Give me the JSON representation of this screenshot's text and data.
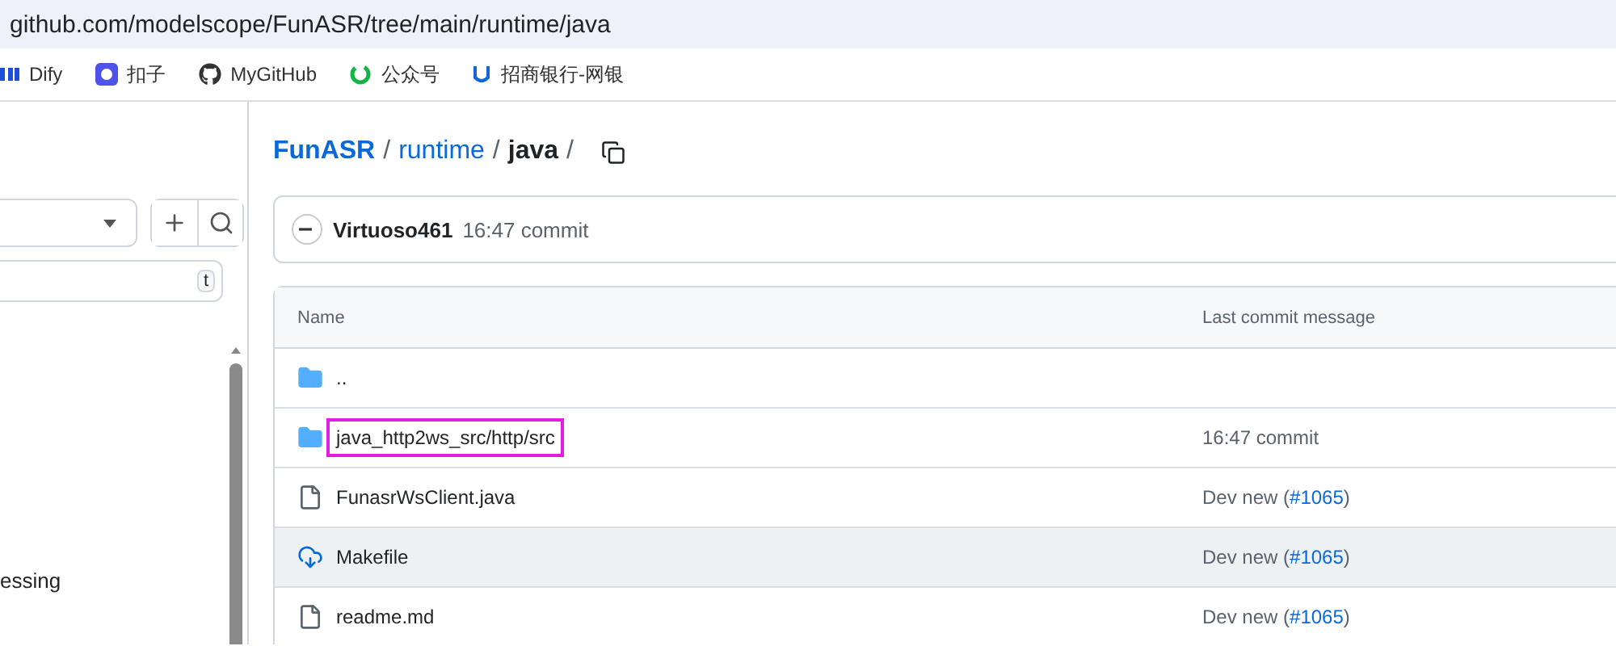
{
  "browser": {
    "url": "github.com/modelscope/FunASR/tree/main/runtime/java",
    "bookmarks": [
      {
        "label": "Dify"
      },
      {
        "label": "扣子"
      },
      {
        "label": "MyGitHub"
      },
      {
        "label": "公众号"
      },
      {
        "label": "招商银行-网银"
      }
    ]
  },
  "sidebar": {
    "search_shortcut": "t",
    "items": [
      {
        "label": "essing"
      }
    ]
  },
  "breadcrumb": [
    {
      "label": "FunASR",
      "kind": "repo",
      "separator": "/"
    },
    {
      "label": "runtime",
      "kind": "link",
      "separator": "/"
    },
    {
      "label": "java",
      "kind": "current",
      "separator": "/"
    }
  ],
  "latest_commit": {
    "author": "Virtuoso461",
    "message": "16:47 commit"
  },
  "table": {
    "columns": [
      "Name",
      "Last commit message"
    ],
    "rows": [
      {
        "name": "..",
        "kind": "folder",
        "message_before": "",
        "link": "",
        "message_after": "",
        "hovered": false,
        "outlined": false
      },
      {
        "name": "java_http2ws_src/http/src",
        "kind": "folder",
        "message_before": "16:47 commit",
        "link": "",
        "message_after": "",
        "hovered": false,
        "outlined": true
      },
      {
        "name": "FunasrWsClient.java",
        "kind": "file",
        "message_before": "Dev new (",
        "link": "#1065",
        "message_after": ")",
        "hovered": false,
        "outlined": false
      },
      {
        "name": "Makefile",
        "kind": "download",
        "message_before": "Dev new (",
        "link": "#1065",
        "message_after": ")",
        "hovered": true,
        "outlined": false
      },
      {
        "name": "readme.md",
        "kind": "file",
        "message_before": "Dev new (",
        "link": "#1065",
        "message_after": ")",
        "hovered": false,
        "outlined": false
      }
    ]
  }
}
